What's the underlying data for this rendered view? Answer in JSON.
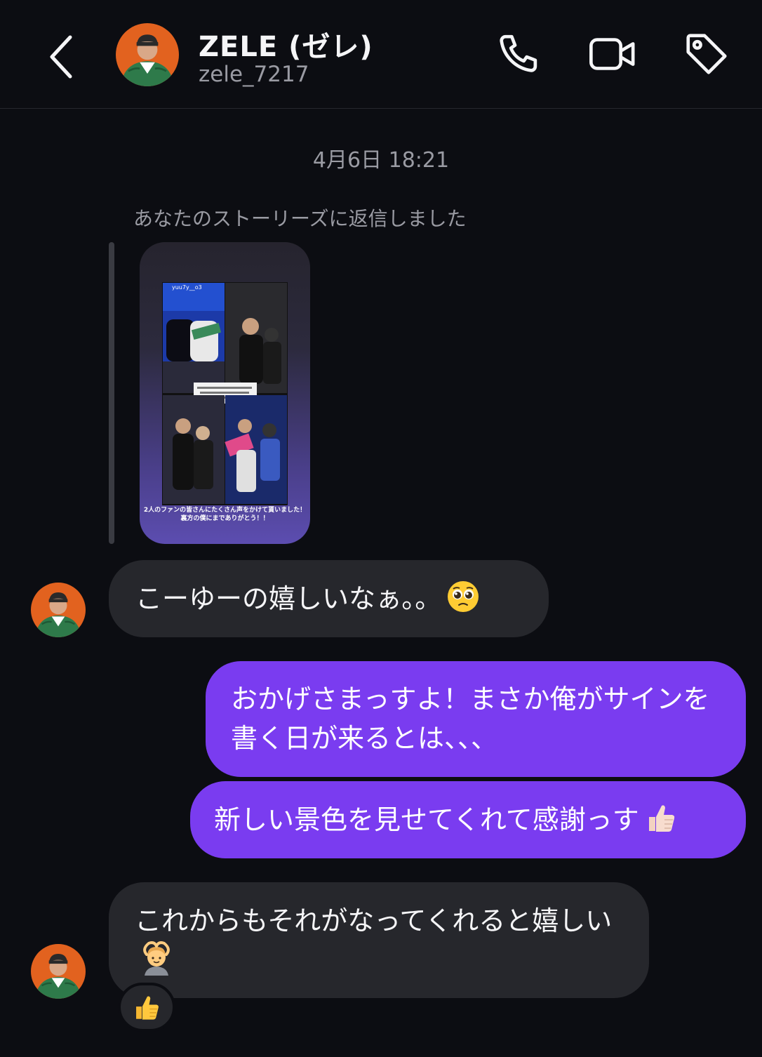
{
  "header": {
    "contact_name": "ZELE (ゼレ)",
    "contact_handle": "zele_7217",
    "icons": [
      "back-icon",
      "phone-icon",
      "video-camera-icon",
      "tag-icon"
    ]
  },
  "conversation": {
    "timestamp": "4月6日 18:21",
    "story_reply_note": "あなたのストーリーズに返信しました",
    "story_preview": {
      "username": "yuu7y__o3",
      "caption_line1": "2人のファンの皆さんにたくさん声をかけて貰いました！",
      "caption_line2": "裏方の僕にまでありがとう！！"
    },
    "messages": [
      {
        "sender": "them",
        "text": "こーゆーの嬉しいなぁ。。",
        "emoji": "pleading-face-emoji"
      },
      {
        "sender": "me",
        "text": "おかげさまっすよ！まさか俺がサインを書く日が来るとは、、、"
      },
      {
        "sender": "me",
        "text": "新しい景色を見せてくれて感謝っす",
        "emoji": "thumbs-up-light-skin-emoji"
      },
      {
        "sender": "them",
        "text": "これからもそれがなってくれると嬉しい",
        "emoji": "person-gesturing-ok-emoji"
      }
    ],
    "reaction": "thumbs-up-emoji"
  },
  "colors": {
    "background": "#0c0d12",
    "incoming_bubble": "#26272c",
    "outgoing_bubble": "#7a3cf0",
    "secondary_text": "#9a9ba3"
  }
}
